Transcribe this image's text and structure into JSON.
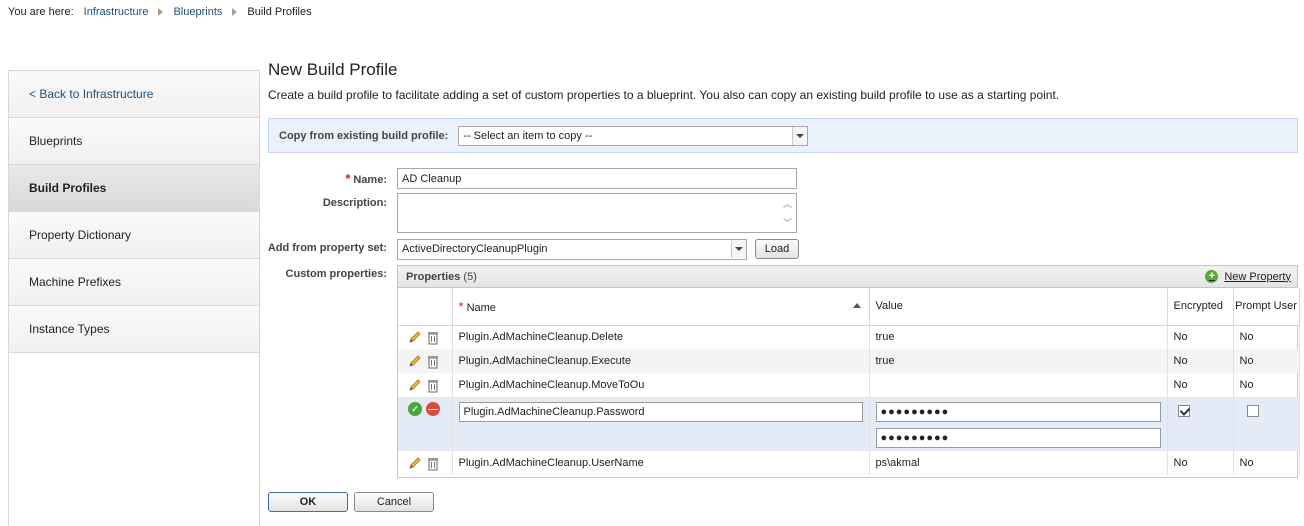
{
  "breadcrumb": {
    "prefix": "You are here:",
    "items": [
      "Infrastructure",
      "Blueprints",
      "Build Profiles"
    ]
  },
  "sidebar": {
    "back": "< Back to Infrastructure",
    "items": [
      {
        "label": "Blueprints",
        "active": false
      },
      {
        "label": "Build Profiles",
        "active": true
      },
      {
        "label": "Property Dictionary",
        "active": false
      },
      {
        "label": "Machine Prefixes",
        "active": false
      },
      {
        "label": "Instance Types",
        "active": false
      }
    ]
  },
  "page": {
    "title": "New Build Profile",
    "subtitle": "Create a build profile to facilitate adding a set of custom properties to a blueprint. You also can copy an existing build profile to use as a starting point."
  },
  "copy_from": {
    "label": "Copy from existing build profile:",
    "value": "-- Select an item to copy --"
  },
  "form": {
    "name_label": "Name:",
    "name_value": "AD Cleanup",
    "description_label": "Description:",
    "description_value": "",
    "property_set_label": "Add from property set:",
    "property_set_value": "ActiveDirectoryCleanupPlugin",
    "load_label": "Load",
    "custom_props_label": "Custom properties:"
  },
  "properties": {
    "title": "Properties",
    "count": "(5)",
    "new_label": "New Property",
    "columns": {
      "name": "Name",
      "value": "Value",
      "encrypted": "Encrypted",
      "prompt": "Prompt User"
    },
    "rows": [
      {
        "name": "Plugin.AdMachineCleanup.Delete",
        "value": "true",
        "encrypted": "No",
        "prompt": "No"
      },
      {
        "name": "Plugin.AdMachineCleanup.Execute",
        "value": "true",
        "encrypted": "No",
        "prompt": "No"
      },
      {
        "name": "Plugin.AdMachineCleanup.MoveToOu",
        "value": "",
        "encrypted": "No",
        "prompt": "No"
      }
    ],
    "edit_row": {
      "name": "Plugin.AdMachineCleanup.Password",
      "value": "●●●●●●●●●",
      "confirm": "●●●●●●●●●",
      "encrypted": true,
      "prompt": false
    },
    "last_row": {
      "name": "Plugin.AdMachineCleanup.UserName",
      "value": "ps\\akmal",
      "encrypted": "No",
      "prompt": "No"
    }
  },
  "actions": {
    "ok": "OK",
    "cancel": "Cancel"
  }
}
